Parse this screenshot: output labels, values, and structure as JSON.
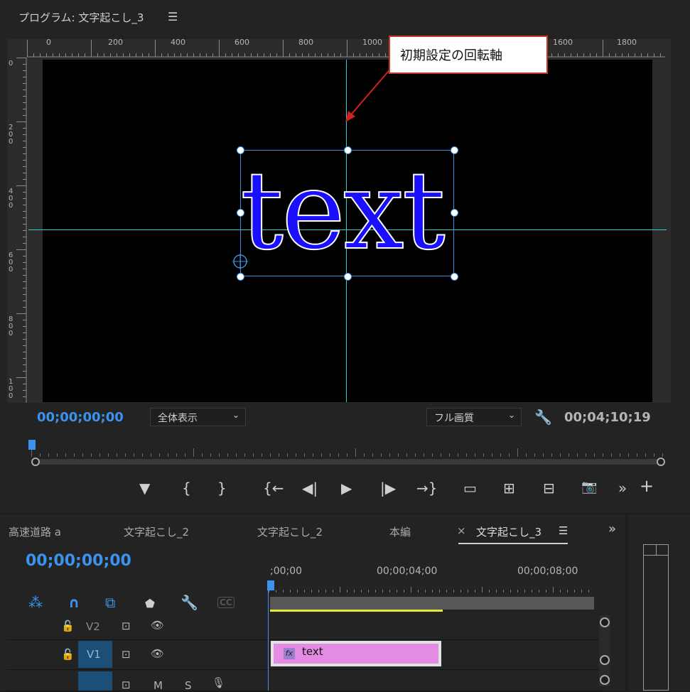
{
  "program_monitor": {
    "title": "プログラム: 文字起こし_3",
    "menu_icon": "☰",
    "ruler_top_labels": [
      "0",
      "200",
      "400",
      "600",
      "800",
      "1000",
      "1600",
      "1800"
    ],
    "ruler_left_labels": [
      "0",
      "200",
      "400",
      "600",
      "800",
      "100"
    ],
    "preview_text": "text",
    "callout_text": "初期設定の回転軸",
    "timecode": "00;00;00;00",
    "zoom_label": "全体表示",
    "quality_label": "フル画質",
    "duration": "00;04;10;19"
  },
  "transport": {
    "marker": "▼",
    "in": "{",
    "out": "}",
    "go_in": "{←",
    "step_back": "◀|",
    "play": "▶",
    "step_fwd": "|▶",
    "go_out": "→}",
    "lift": "▭",
    "extract": "⊞",
    "overwrite": "⊟",
    "camera": "📷",
    "more": "»",
    "add": "+"
  },
  "timeline": {
    "tabs": [
      "高速道路 a",
      "文字起こし_2",
      "文字起こし_2",
      "本編",
      "文字起こし_3"
    ],
    "close": "×",
    "active_menu": "☰",
    "more_tabs": "»",
    "timecode": "00;00;00;00",
    "ruler_labels": [
      ";00;00",
      "00;00;04;00",
      "00;00;08;00"
    ],
    "tools": {
      "snap": "⁂",
      "magnet": "∩",
      "linked": "⧉",
      "marker": "⬟",
      "wrench": "🔧",
      "cc": "CC"
    },
    "tracks": {
      "v2": {
        "label": "V2",
        "lock": "🔓",
        "sync": "⊡",
        "eye": "👁"
      },
      "v1": {
        "label": "V1",
        "lock": "🔓",
        "sync": "⊡",
        "eye": "👁"
      },
      "a": {
        "sync": "⊡",
        "mute": "M",
        "solo": "S",
        "mic": "🎙"
      }
    },
    "clip": {
      "fx": "fx",
      "label": "text"
    }
  },
  "colors": {
    "accent": "#3b93ee",
    "guide": "#2fd0d0",
    "text_fill": "#1a10ff",
    "clip": "#e48ce4"
  }
}
